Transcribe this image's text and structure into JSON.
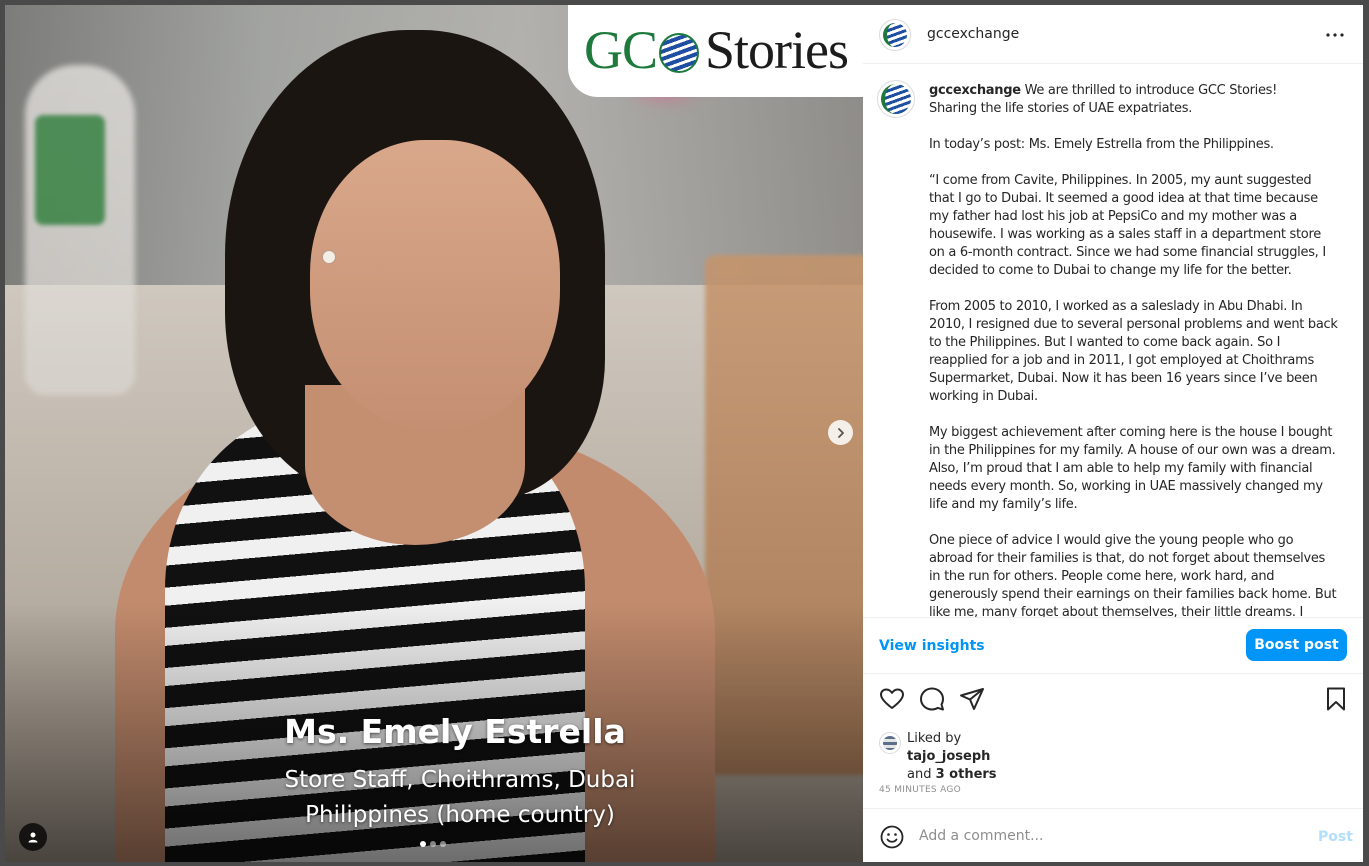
{
  "post_image": {
    "logo_text_left": "GC",
    "logo_text_right": "Stories",
    "name": "Ms. Emely Estrella",
    "role": "Store Staff, Choithrams, Dubai",
    "country": "Philippines (home country)",
    "carousel_total": 3,
    "carousel_active": 1
  },
  "header": {
    "username": "gccexchange"
  },
  "caption": {
    "username": "gccexchange",
    "first_line": "We are thrilled to introduce GCC Stories!",
    "paragraphs": [
      "Sharing the life stories of UAE expatriates.",
      "In today’s post: Ms. Emely Estrella from the Philippines.",
      "“I come from Cavite, Philippines. In 2005, my aunt suggested that I go to Dubai. It seemed a good idea at that time because my father had lost his job at PepsiCo and my mother was a housewife. I was working as a sales staff in a department store on a 6-month contract. Since we had some financial struggles, I decided to come to Dubai to change my life for the better.",
      "From 2005 to 2010, I worked as a saleslady in Abu Dhabi. In 2010, I resigned due to several personal problems and went back to the Philippines. But I wanted to come back again. So I reapplied for a job and in 2011, I got employed at Choithrams Supermarket, Dubai. Now it has been 16 years since I’ve been working in Dubai.",
      "My biggest achievement after coming here is the house I bought in the Philippines for my family. A house of our own was a dream. Also, I’m proud that I am able to help my family with financial needs every month. So, working in UAE massively changed my life and my family’s life.",
      "One piece of advice I would give the young people who go abroad for their families is that, do not forget about themselves in the run for others. People come here, work hard, and generously spend their earnings on their families back home. But like me, many forget about themselves, their little dreams. I"
    ]
  },
  "insights": {
    "view_label": "View insights",
    "boost_label": "Boost post"
  },
  "likes": {
    "prefix": "Liked by",
    "user": "tajo_joseph",
    "and": "and",
    "others": "3 others"
  },
  "time_ago": "45 MINUTES AGO",
  "comment_box": {
    "placeholder": "Add a comment...",
    "post_label": "Post"
  },
  "icons": {
    "like": "heart-icon",
    "comment": "comment-icon",
    "share": "send-icon",
    "save": "bookmark-icon",
    "more": "more-icon",
    "emoji": "emoji-icon",
    "next": "chevron-right-icon",
    "tag": "user-tag-icon"
  },
  "colors": {
    "accent": "#0095f6",
    "brand_green": "#1d7a3c",
    "brand_blue": "#1f4fa3"
  }
}
